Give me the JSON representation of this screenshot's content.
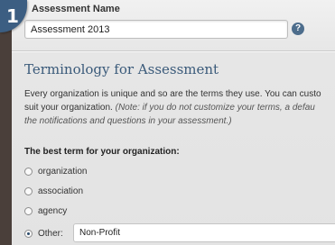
{
  "step": {
    "number": "1"
  },
  "assessment": {
    "label": "Assessment Name",
    "value": "Assessment 2013",
    "help_icon": "question-icon",
    "help_glyph": "?"
  },
  "terminology": {
    "heading": "Terminology for Assessment",
    "description_line1": "Every organization is unique and so are the terms they use. You can custo",
    "description_line2_start": "suit your organization. ",
    "description_note_line2": "(Note: if you do not customize your terms, a defau",
    "description_note_line3": "the notifications and questions in your assessment.)",
    "question": "The best term for your organization:",
    "options": [
      {
        "label": "organization",
        "checked": false
      },
      {
        "label": "association",
        "checked": false
      },
      {
        "label": "agency",
        "checked": false
      },
      {
        "label": "Other:",
        "checked": true
      }
    ],
    "other_value": "Non-Profit"
  },
  "colors": {
    "accent": "#3c5e82",
    "heading": "#3a5a7a",
    "background_left": "#4a3f3a"
  }
}
